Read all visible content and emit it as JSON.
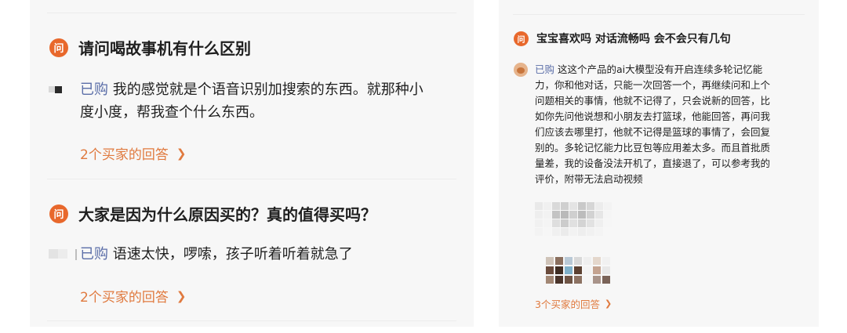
{
  "left": {
    "questions": [
      {
        "badge": "问",
        "title": "请问喝故事机有什么区别",
        "answer_tag": "已购",
        "answer_line1": "我的感觉就是个语音识别加搜索的东西。就那种小",
        "answer_line2": "度小度，帮我查个什么东西。",
        "more_label": "2个买家的回答",
        "more_icon": "chevron-right"
      },
      {
        "badge": "问",
        "title": "大家是因为什么原因买的？真的值得买吗？",
        "answer_tag": "已购",
        "answer_line1": "语速太快，啰嗦，孩子听着听着就急了",
        "more_label": "2个买家的回答",
        "more_icon": "chevron-right"
      }
    ]
  },
  "right": {
    "badge": "问",
    "title": "宝宝喜欢吗 对话流畅吗 会不会只有几句",
    "answer_tag": "已购",
    "answer_lines": [
      "这这个产品的ai大模型没有开启连续多轮记忆能",
      "力，你和他对话，只能一次回答一个，再继续问和上个",
      "问题相关的事情，他就不记得了，只会说新的回答，比",
      "如你先问他说想和小朋友去打篮球，他能回答，再问我",
      "们应该去哪里打，他就不记得是篮球的事情了，会回复",
      "别的。多轮记忆能力比豆包等应用差太多。而且首批质",
      "量差，我的设备没法开机了，直接退了，可以参考我的",
      "评价，附带无法启动视频"
    ],
    "more_label": "3个买家的回答",
    "more_icon": "chevron-right"
  },
  "colors": {
    "accent": "#e8682c",
    "link": "#e07a3f",
    "purchased_tag": "#5b6ea8",
    "panel_bg": "#f7f7f7"
  }
}
